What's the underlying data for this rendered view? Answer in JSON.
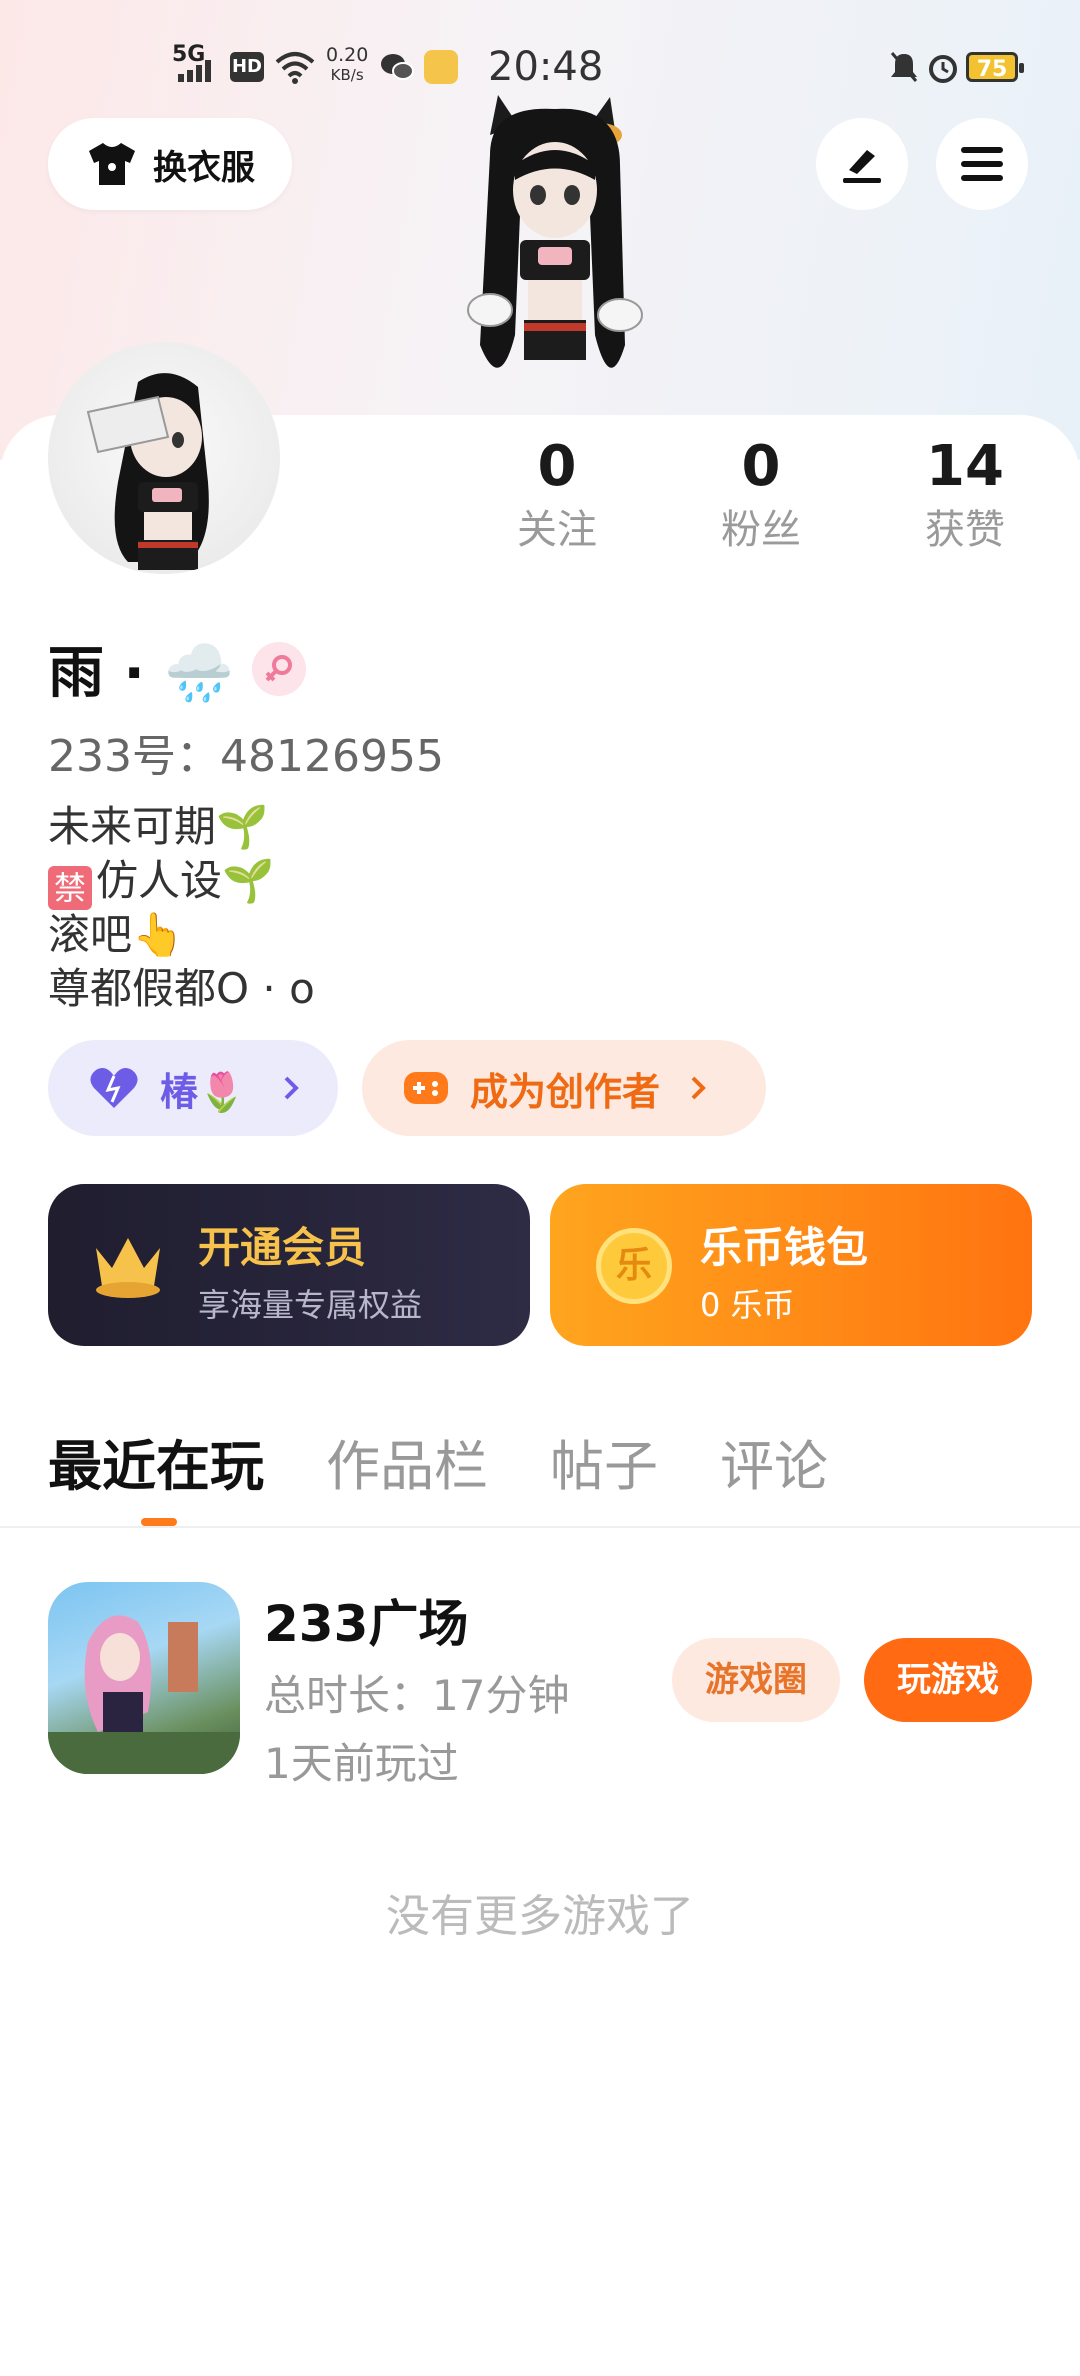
{
  "status_bar": {
    "network": "5G",
    "hd": "HD",
    "speed": "0.20",
    "speed_unit": "KB/s",
    "time": "20:48",
    "battery": "75",
    "icons": [
      "signal-icon",
      "hd-icon",
      "wifi-icon",
      "wechat-icon",
      "app-notification-icon",
      "mute-icon",
      "alarm-icon",
      "battery-icon"
    ]
  },
  "header": {
    "dress_button": "换衣服",
    "edit_icon": "edit-icon",
    "menu_icon": "menu-icon"
  },
  "stats": [
    {
      "value": "0",
      "label": "关注"
    },
    {
      "value": "0",
      "label": "粉丝"
    },
    {
      "value": "14",
      "label": "获赞"
    }
  ],
  "profile": {
    "name": "雨 · 🌧️",
    "gender": "female",
    "uid": "233号：48126955",
    "bio": [
      "未来可期🌱",
      "仿人设🌱",
      "滚吧👆",
      "尊都假都O · o"
    ],
    "bio_ban_label": "禁"
  },
  "pills": {
    "camellia": "椿🌷",
    "creator": "成为创作者"
  },
  "vip": {
    "title": "开通会员",
    "subtitle": "享海量专属权益"
  },
  "wallet": {
    "title": "乐币钱包",
    "subtitle": "0 乐币",
    "coin_glyph": "乐"
  },
  "tabs": [
    "最近在玩",
    "作品栏",
    "帖子",
    "评论"
  ],
  "game": {
    "name": "233广场",
    "duration": "总时长：17分钟",
    "last_played": "1天前玩过",
    "circle_button": "游戏圈",
    "play_button": "玩游戏"
  },
  "empty_text": "没有更多游戏了",
  "colors": {
    "accent": "#ff6a12",
    "vip_gold": "#f6c24c",
    "purple": "#6d5ce6"
  }
}
